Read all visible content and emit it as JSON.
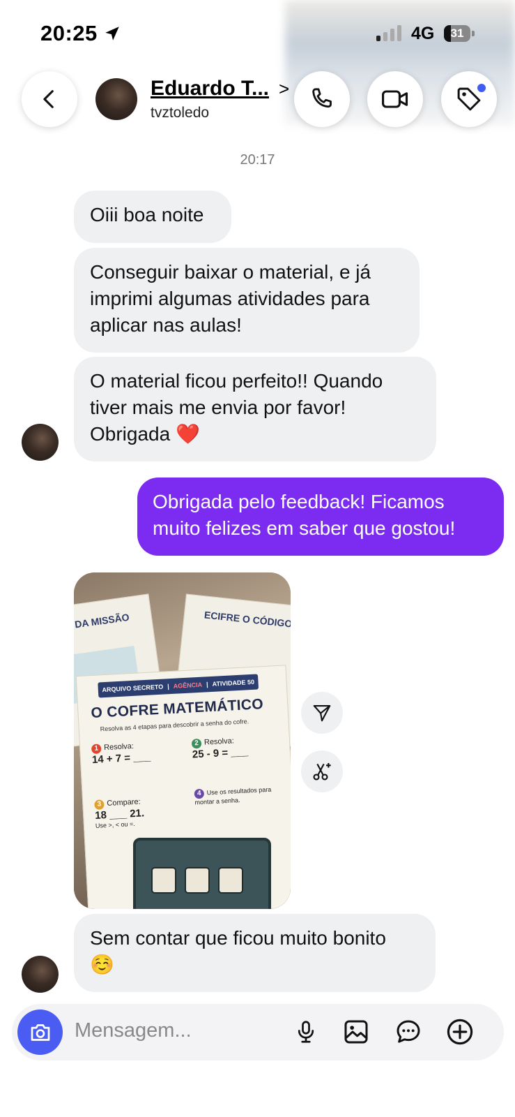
{
  "status_bar": {
    "time": "20:25",
    "network": "4G",
    "battery": "31"
  },
  "header": {
    "contact_name": "Eduardo T...",
    "username": "tvztoledo",
    "chevron": ">"
  },
  "thread": {
    "timestamp": "20:17",
    "messages": [
      {
        "text": "Oiii boa noite"
      },
      {
        "text": "Conseguir baixar o material, e já imprimi algumas atividades para aplicar nas aulas!"
      },
      {
        "text": "O material ficou perfeito!! Quando tiver mais me envia por favor! Obrigada",
        "emoji": "❤️"
      },
      {
        "text": "Obrigada pelo feedback! Ficamos muito felizes em saber que gostou!"
      },
      {
        "text": "Sem contar que ficou muito bonito",
        "emoji": "☺️"
      }
    ],
    "shared_image": {
      "banner_left": "ARQUIVO SECRETO",
      "banner_mid": "AGÊNCIA",
      "banner_right": "ATIVIDADE 50",
      "title": "O COFRE MATEMÁTICO",
      "subtitle": "Resolva as 4 etapas para descobrir a senha do cofre.",
      "sheet_left_title": "DA MISSÃO",
      "sheet_right_title": "ECIFRE O CÓDIGO",
      "step1_label": "Resolva:",
      "step1_expr": "14 + 7 = ___",
      "step2_label": "Resolva:",
      "step2_expr": "25 - 9 = ___",
      "step3_label": "Compare:",
      "step3_expr": "18 ___ 21.",
      "step3_hint": "Use >, < ou =.",
      "step4_text": "Use os resultados para montar a senha."
    }
  },
  "composer": {
    "placeholder": "Mensagem..."
  },
  "colors": {
    "outgoing": "#7b2cf0",
    "incoming": "#eff0f2",
    "camera": "#4b5cf2",
    "unread_dot": "#3f5cf3"
  }
}
